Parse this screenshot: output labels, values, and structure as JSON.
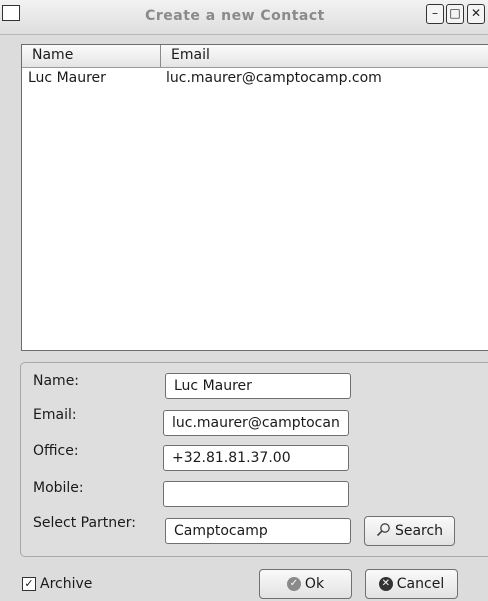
{
  "window": {
    "title": "Create a new Contact",
    "minimize_glyph": "–",
    "maximize_glyph": "□",
    "close_glyph": "✕"
  },
  "list": {
    "columns": [
      "Name",
      "Email"
    ],
    "rows": [
      {
        "name": "Luc Maurer",
        "email": "luc.maurer@camptocamp.com"
      }
    ]
  },
  "form": {
    "name_label": "Name:",
    "name_value": "Luc Maurer",
    "email_label": "Email:",
    "email_value": "luc.maurer@camptocan",
    "office_label": "Office:",
    "office_value": "+32.81.81.37.00",
    "mobile_label": "Mobile:",
    "mobile_value": "",
    "partner_label": "Select Partner:",
    "partner_value": "Camptocamp",
    "search_label": "Search"
  },
  "footer": {
    "archive_label": "Archive",
    "archive_checked": true,
    "ok_label": "Ok",
    "cancel_label": "Cancel"
  }
}
